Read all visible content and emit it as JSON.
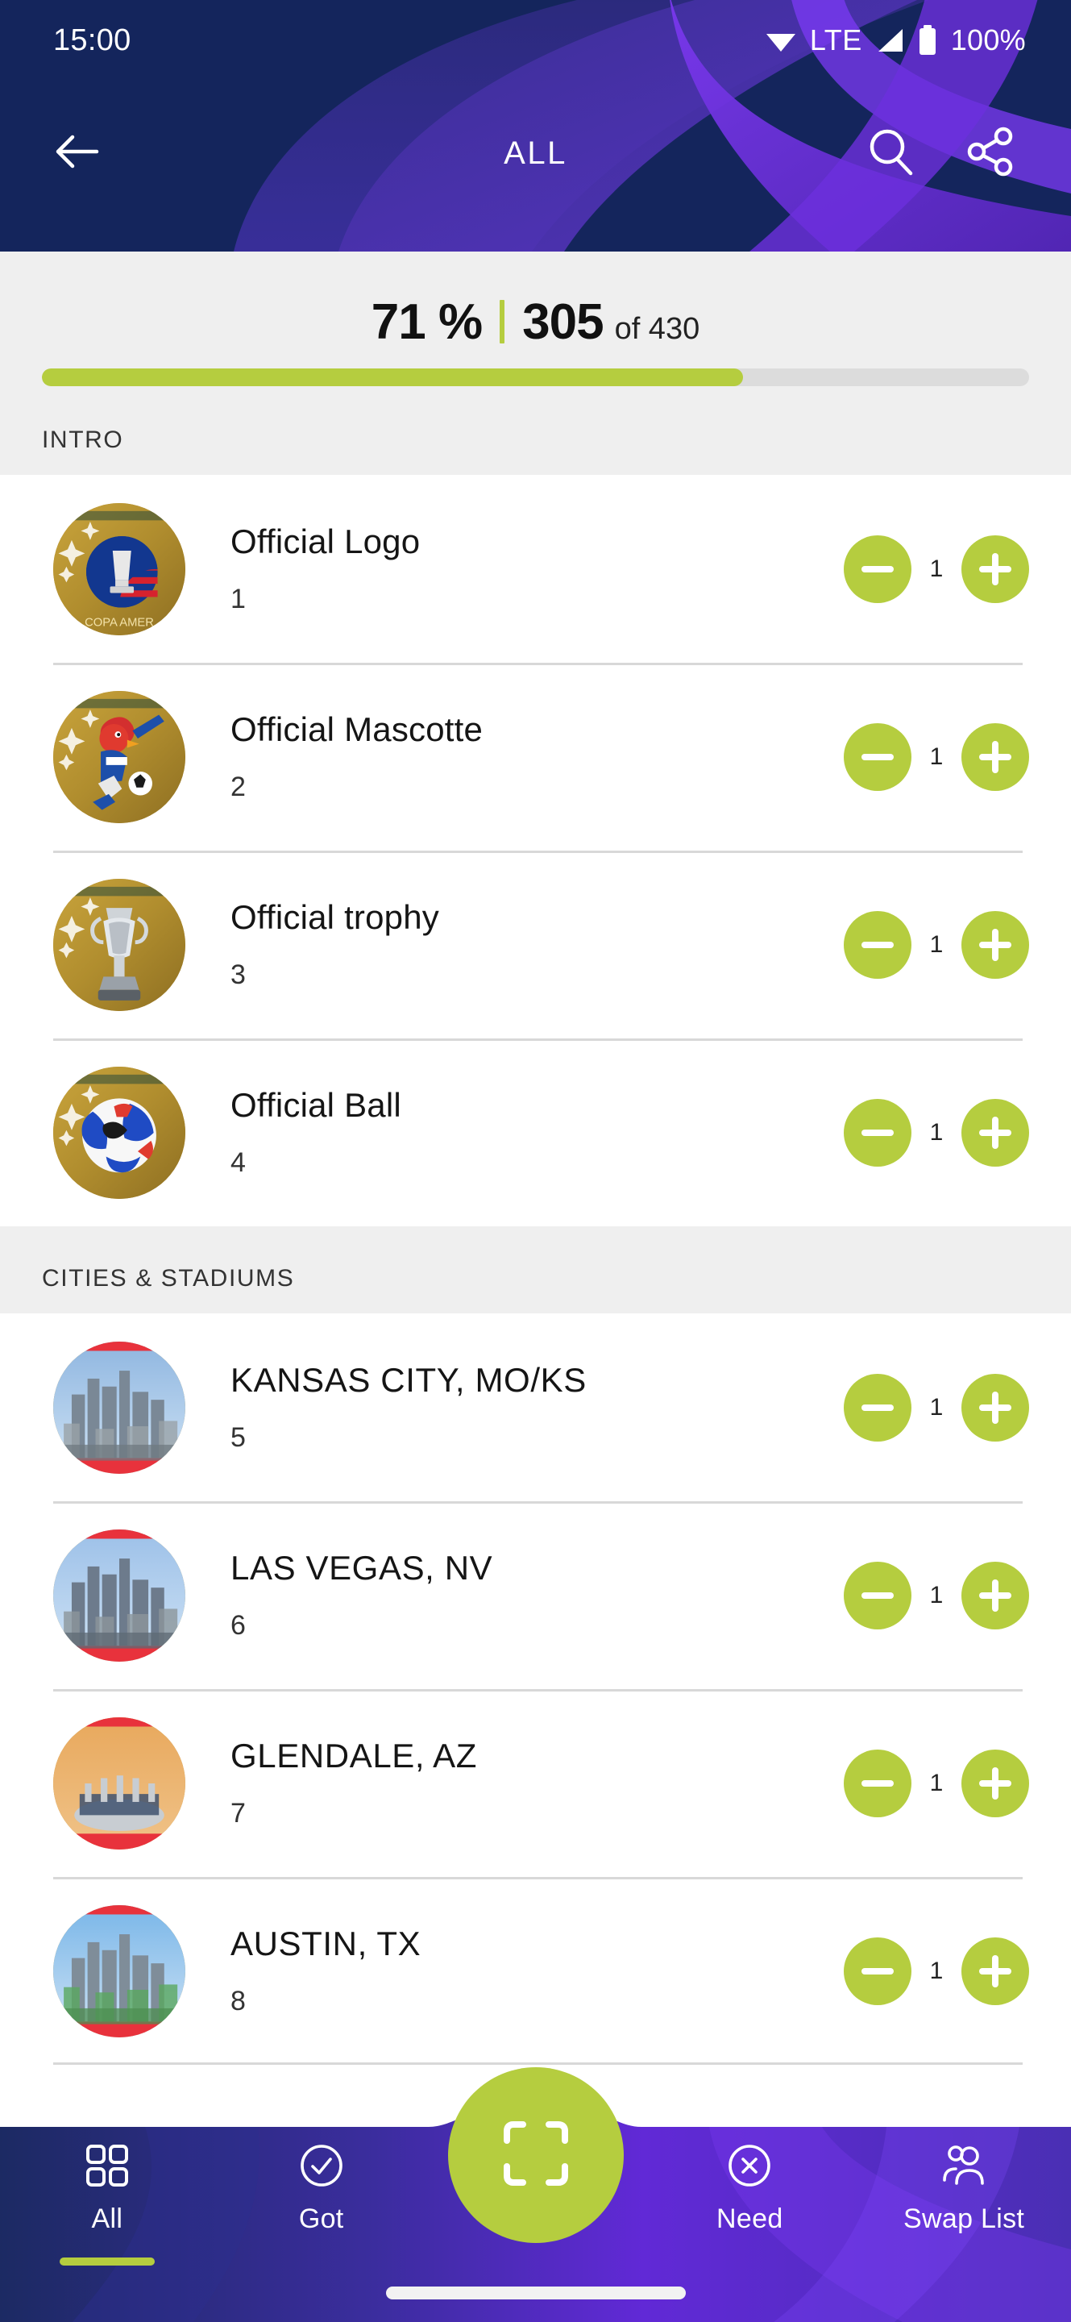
{
  "colors": {
    "navy": "#14255c",
    "purple": "#6a2fd4",
    "accent_green": "#b5cd3f",
    "panel_gray": "#efefef",
    "separator": "#d8d8d8"
  },
  "status_bar": {
    "time": "15:00",
    "wifi_icon": "wifi-icon",
    "network_label": "LTE",
    "signal_icon": "signal-icon",
    "battery_icon": "battery-icon",
    "battery_percent": "100%"
  },
  "app_bar": {
    "back_icon": "back-arrow-icon",
    "title": "ALL",
    "search_icon": "search-icon",
    "share_icon": "share-icon"
  },
  "progress": {
    "percent_label": "71 %",
    "percent_value": 71,
    "collected": "305",
    "of_label": "of 430",
    "total": 430
  },
  "sections": [
    {
      "header": "INTRO",
      "items": [
        {
          "title": "Official Logo",
          "number": "1",
          "count": "1",
          "thumb": "copa-logo-sticker",
          "decrement_icon": "minus-icon",
          "increment_icon": "plus-icon"
        },
        {
          "title": "Official Mascotte",
          "number": "2",
          "count": "1",
          "thumb": "mascot-sticker",
          "decrement_icon": "minus-icon",
          "increment_icon": "plus-icon"
        },
        {
          "title": "Official trophy",
          "number": "3",
          "count": "1",
          "thumb": "trophy-sticker",
          "decrement_icon": "minus-icon",
          "increment_icon": "plus-icon"
        },
        {
          "title": "Official Ball",
          "number": "4",
          "count": "1",
          "thumb": "ball-sticker",
          "decrement_icon": "minus-icon",
          "increment_icon": "plus-icon"
        }
      ]
    },
    {
      "header": "CITIES & STADIUMS",
      "items": [
        {
          "title": "KANSAS CITY, MO/KS",
          "number": "5",
          "count": "1",
          "thumb": "kansas-city-photo",
          "decrement_icon": "minus-icon",
          "increment_icon": "plus-icon"
        },
        {
          "title": "LAS VEGAS, NV",
          "number": "6",
          "count": "1",
          "thumb": "las-vegas-photo",
          "decrement_icon": "minus-icon",
          "increment_icon": "plus-icon"
        },
        {
          "title": "GLENDALE, AZ",
          "number": "7",
          "count": "1",
          "thumb": "glendale-photo",
          "decrement_icon": "minus-icon",
          "increment_icon": "plus-icon"
        },
        {
          "title": "AUSTIN, TX",
          "number": "8",
          "count": "1",
          "thumb": "austin-photo",
          "decrement_icon": "minus-icon",
          "increment_icon": "plus-icon"
        }
      ]
    }
  ],
  "bottom_nav": {
    "items": [
      {
        "label": "All",
        "icon": "grid-icon",
        "active": true
      },
      {
        "label": "Got",
        "icon": "check-circle-icon",
        "active": false
      },
      {
        "label": "",
        "icon": "scan-icon",
        "active": false
      },
      {
        "label": "Need",
        "icon": "x-circle-icon",
        "active": false
      },
      {
        "label": "Swap List",
        "icon": "people-icon",
        "active": false
      }
    ],
    "fab_icon": "scan-icon"
  }
}
